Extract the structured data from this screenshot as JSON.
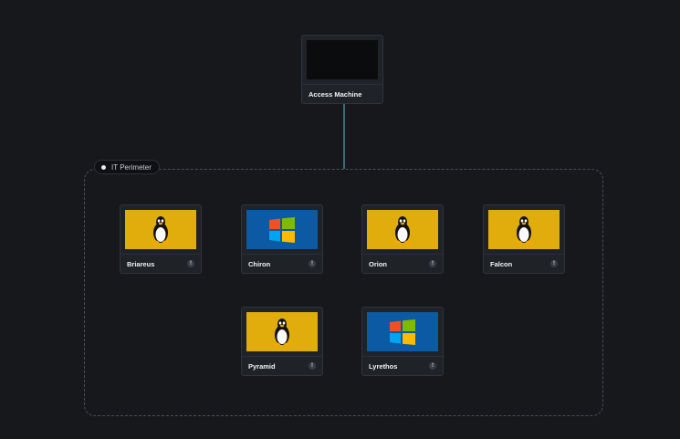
{
  "access_machine": {
    "name": "Access Machine",
    "os_icon": "blank-screen"
  },
  "perimeter": {
    "label": "IT Perimeter"
  },
  "machines": [
    {
      "name": "Briareus",
      "os": "linux",
      "os_icon": "tux-penguin-icon",
      "info": "!"
    },
    {
      "name": "Chiron",
      "os": "windows",
      "os_icon": "windows-logo-icon",
      "info": "!"
    },
    {
      "name": "Orion",
      "os": "linux",
      "os_icon": "tux-penguin-icon",
      "info": "!"
    },
    {
      "name": "Falcon",
      "os": "linux",
      "os_icon": "tux-penguin-icon",
      "info": "!"
    },
    {
      "name": "Pyramid",
      "os": "linux",
      "os_icon": "tux-penguin-icon",
      "info": "!"
    },
    {
      "name": "Lyrethos",
      "os": "windows",
      "os_icon": "windows-logo-icon",
      "info": "!"
    }
  ],
  "colors": {
    "background": "#16181c",
    "linux_screen": "#e1ad0d",
    "windows_screen": "#0d5aa4",
    "connector": "#3f6b73"
  }
}
